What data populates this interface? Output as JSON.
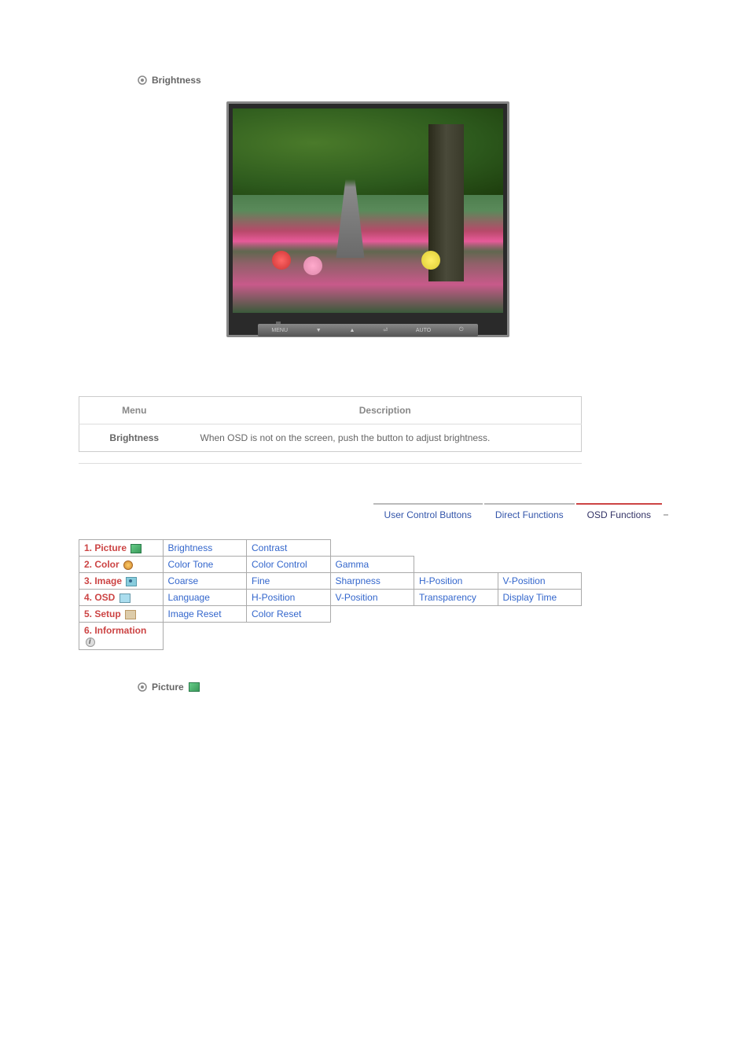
{
  "sections": {
    "brightness_title": "Brightness",
    "picture_title": "Picture"
  },
  "monitor_buttons": {
    "menu": "MENU",
    "down": "▼",
    "up": "▲",
    "enter": "⏎",
    "auto": "AUTO",
    "power": "⏻"
  },
  "desc_table": {
    "headers": {
      "menu": "Menu",
      "description": "Description"
    },
    "rows": [
      {
        "menu": "Brightness",
        "description": "When OSD is not on the screen, push the button to adjust brightness."
      }
    ]
  },
  "tabs": {
    "user_control": "User Control Buttons",
    "direct_functions": "Direct Functions",
    "osd_functions": "OSD Functions"
  },
  "menu_categories": {
    "picture": "1. Picture",
    "color": "2. Color",
    "image": "3. Image",
    "osd": "4. OSD",
    "setup": "5. Setup",
    "information": "6. Information"
  },
  "menu_items": {
    "picture": {
      "brightness": "Brightness",
      "contrast": "Contrast"
    },
    "color": {
      "color_tone": "Color Tone",
      "color_control": "Color Control",
      "gamma": "Gamma"
    },
    "image": {
      "coarse": "Coarse",
      "fine": "Fine",
      "sharpness": "Sharpness",
      "h_position": "H-Position",
      "v_position": "V-Position"
    },
    "osd": {
      "language": "Language",
      "h_position": "H-Position",
      "v_position": "V-Position",
      "transparency": "Transparency",
      "display_time": "Display Time"
    },
    "setup": {
      "image_reset": "Image Reset",
      "color_reset": "Color Reset"
    }
  }
}
